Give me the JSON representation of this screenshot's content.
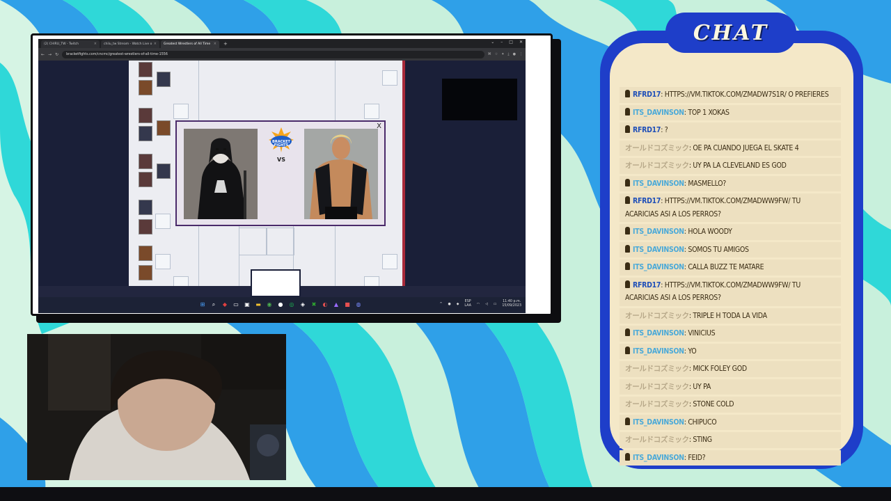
{
  "browser": {
    "tabs": [
      {
        "label": "(2) CHIRU_TW - Twitch",
        "active": false
      },
      {
        "label": "chilu_tw Stream - Watch Live o",
        "active": false
      },
      {
        "label": "Greatest Wrestlers of All Time",
        "active": true
      }
    ],
    "new_tab": "+",
    "url": "bracketfights.com/cncmc/greatest-wrestlers-of-all-time-1556"
  },
  "modal": {
    "close": "X",
    "vs": "VS",
    "logo_text": "BRACKET FIGHTS"
  },
  "taskbar": {
    "lang_top": "ESP",
    "lang_bottom": "LAA",
    "time": "11:40 p.m.",
    "date": "15/09/2023"
  },
  "chat": {
    "title": "CHAT",
    "messages": [
      {
        "user": "RFRD17",
        "text": ": HTTPS://VM.TIKTOK.COM/ZMADW7S1R/ O PREFIERES",
        "style": "blue",
        "badge": true
      },
      {
        "user": "ITS_DAVINSON",
        "text": ": TOP 1 XOKAS",
        "style": "cyan",
        "badge": true
      },
      {
        "user": "RFRD17",
        "text": ": ?",
        "style": "blue",
        "badge": true
      },
      {
        "user": "オールドコズミック",
        "text": ": OE PA CUANDO JUEGA EL SKATE 4",
        "style": "tan",
        "badge": false
      },
      {
        "user": "オールドコズミック",
        "text": ": UY PA LA CLEVELAND ES GOD",
        "style": "tan",
        "badge": false
      },
      {
        "user": "ITS_DAVINSON",
        "text": ": MASMELLO?",
        "style": "cyan",
        "badge": true
      },
      {
        "user": "RFRD17",
        "text": ": HTTPS://VM.TIKTOK.COM/ZMADWW9FW/ TU ACARICIAS ASI A LOS PERROS?",
        "style": "blue",
        "badge": true
      },
      {
        "user": "ITS_DAVINSON",
        "text": ": HOLA WOODY",
        "style": "cyan",
        "badge": true
      },
      {
        "user": "ITS_DAVINSON",
        "text": ": SOMOS TU AMIGOS",
        "style": "cyan",
        "badge": true
      },
      {
        "user": "ITS_DAVINSON",
        "text": ": CALLA BUZZ TE MATARE",
        "style": "cyan",
        "badge": true
      },
      {
        "user": "RFRD17",
        "text": ": HTTPS://VM.TIKTOK.COM/ZMADWW9FW/ TU ACARICIAS ASI A LOS PERROS?",
        "style": "blue",
        "badge": true
      },
      {
        "user": "オールドコズミック",
        "text": ": TRIPLE H TODA LA VIDA",
        "style": "tan",
        "badge": false
      },
      {
        "user": "ITS_DAVINSON",
        "text": ": VINICIUS",
        "style": "cyan",
        "badge": true
      },
      {
        "user": "ITS_DAVINSON",
        "text": ": YO",
        "style": "cyan",
        "badge": true
      },
      {
        "user": "オールドコズミック",
        "text": ": MICK FOLEY GOD",
        "style": "tan",
        "badge": false
      },
      {
        "user": "オールドコズミック",
        "text": ": UY PA",
        "style": "tan",
        "badge": false
      },
      {
        "user": "オールドコズミック",
        "text": ": STONE COLD",
        "style": "tan",
        "badge": false
      },
      {
        "user": "ITS_DAVINSON",
        "text": ": CHIPUCO",
        "style": "cyan",
        "badge": true
      },
      {
        "user": "オールドコズミック",
        "text": ": STING",
        "style": "tan",
        "badge": false
      },
      {
        "user": "ITS_DAVINSON",
        "text": ": FEID?",
        "style": "cyan",
        "badge": true
      }
    ]
  },
  "colors": {
    "chat_panel": "#1e3ec9",
    "chat_bg": "#f4e8c8",
    "wave_blue": "#2fa0e8",
    "wave_cyan": "#2fd8d8",
    "wave_mint": "#c8f0dc"
  },
  "icons": [
    "search-icon",
    "windows-start-icon",
    "close-icon",
    "reload-icon",
    "back-icon",
    "forward-icon",
    "wifi-icon",
    "volume-icon",
    "battery-icon"
  ]
}
